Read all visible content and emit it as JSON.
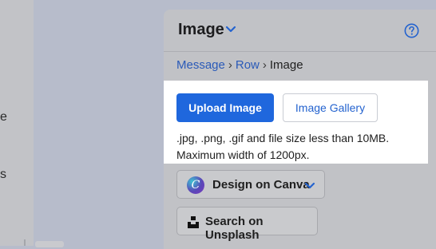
{
  "left_panel": {
    "fragment_1": "e",
    "fragment_2": "s"
  },
  "panel": {
    "title": "Image",
    "title_chevron_icon": "chevron-down-icon",
    "help_icon": "question-circle-icon"
  },
  "breadcrumb": {
    "items": [
      "Message",
      "Row",
      "Image"
    ],
    "separator": "›"
  },
  "actions": {
    "upload_label": "Upload Image",
    "gallery_label": "Image Gallery"
  },
  "hint": {
    "line1": ".jpg, .png, .gif and file size less than 10MB.",
    "line2": "Maximum width of 1200px."
  },
  "canva": {
    "logo_letter": "C",
    "label": "Design on Canva",
    "chevron_icon": "chevron-down-icon"
  },
  "unsplash": {
    "logo_icon": "unsplash-icon",
    "label": "Search on Unsplash"
  },
  "colors": {
    "primary": "#1f67dd",
    "link": "#2a5ab8",
    "overlay": "#b7bccb"
  }
}
